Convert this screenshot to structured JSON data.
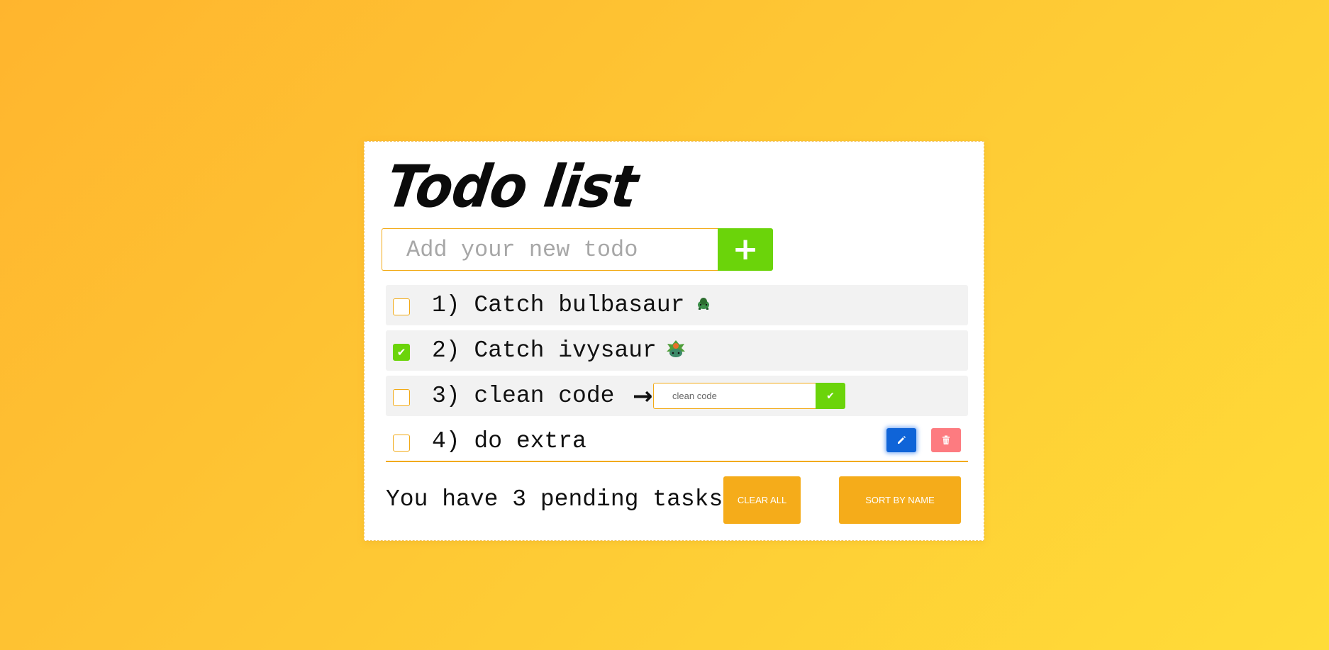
{
  "app": {
    "title": "Todo list"
  },
  "add_todo": {
    "placeholder": "Add your new todo",
    "button_icon": "plus-icon"
  },
  "todos": [
    {
      "label": "1) Catch bulbasaur",
      "done": false,
      "icon": "bulbasaur-sprite-icon"
    },
    {
      "label": "2) Catch ivysaur",
      "done": true,
      "icon": "ivysaur-sprite-icon"
    },
    {
      "label": "3) clean code",
      "done": false,
      "editing": true,
      "edit_value": "clean code",
      "arrow_icon": "arrow-right-icon",
      "confirm_icon": "check-icon"
    },
    {
      "label": "4) do extra",
      "done": false,
      "actions": [
        "pencil-icon",
        "trash-icon"
      ]
    }
  ],
  "footer": {
    "pending_text": "You have 3 pending tasks",
    "clear_all_label": "CLEAR ALL",
    "sort_label": "SORT BY NAME"
  },
  "colors": {
    "accent_orange": "#f5ac1a",
    "success_green": "#6bd40a",
    "edit_blue": "#0f64d8",
    "delete_red": "#fd7b80"
  }
}
